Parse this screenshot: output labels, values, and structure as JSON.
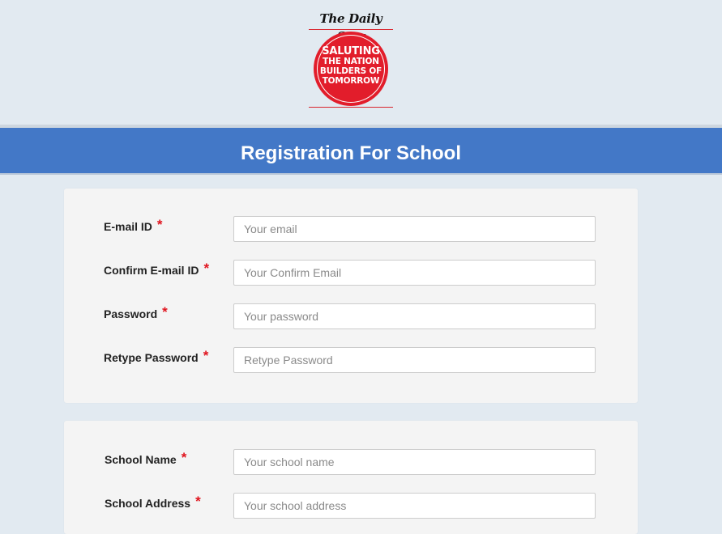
{
  "brand": {
    "masthead": "The Daily Star",
    "badge_lines": [
      "SALUTING",
      "THE NATION",
      "BUILDERS OF",
      "TOMORROW"
    ],
    "badge_color": "#e21d2b"
  },
  "page_title": "Registration For School",
  "accent_color": "#4378c7",
  "required_marker": "*",
  "account_fields": [
    {
      "label": "E-mail ID",
      "placeholder": "Your email",
      "value": ""
    },
    {
      "label": "Confirm E-mail ID",
      "placeholder": "Your Confirm Email",
      "value": ""
    },
    {
      "label": "Password",
      "placeholder": "Your password",
      "value": ""
    },
    {
      "label": "Retype Password",
      "placeholder": "Retype Password",
      "value": ""
    }
  ],
  "school_fields": [
    {
      "label": "School Name",
      "placeholder": "Your school name",
      "value": ""
    },
    {
      "label": "School Address",
      "placeholder": "Your school address",
      "value": ""
    }
  ]
}
